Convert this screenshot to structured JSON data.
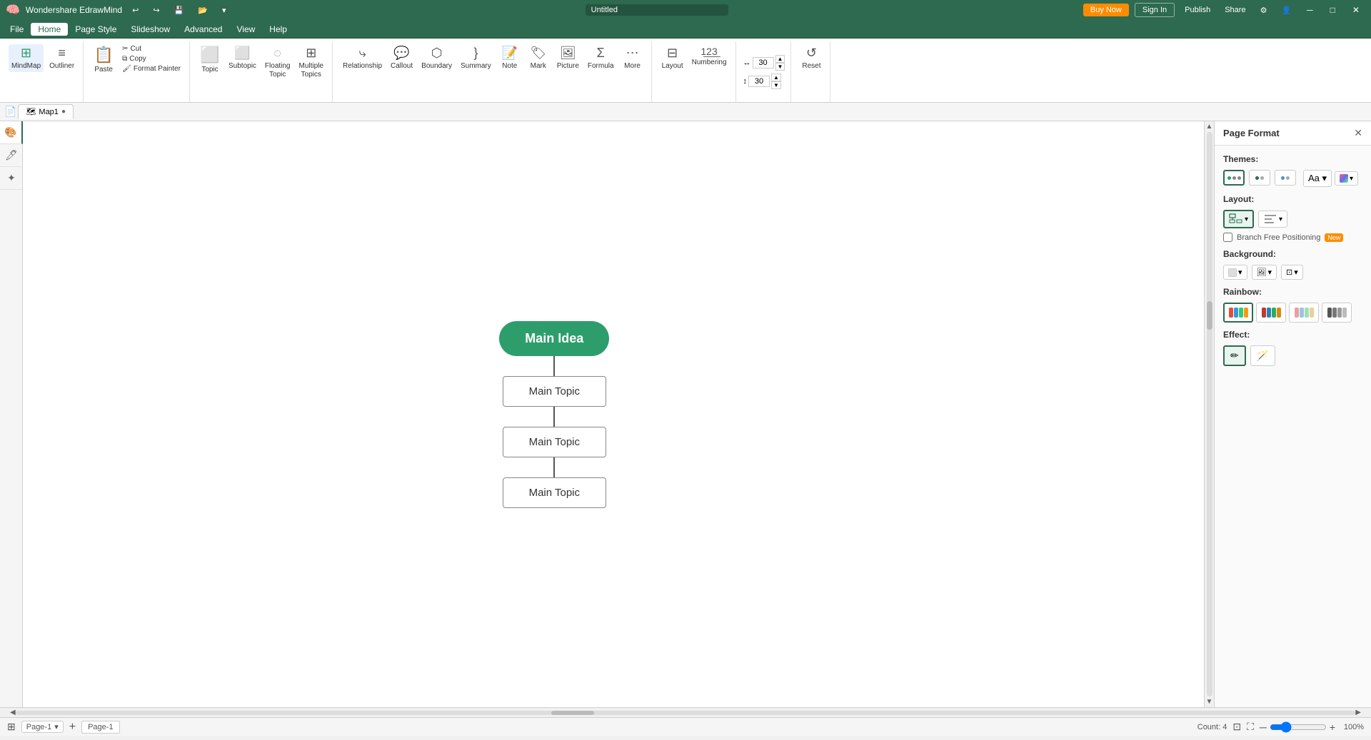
{
  "app": {
    "title": "Wondershare EdrawMind",
    "logo": "🧠"
  },
  "titlebar": {
    "buy_now": "Buy Now",
    "sign_in": "Sign In",
    "publish": "Publish",
    "share": "Share",
    "undo": "↩",
    "redo": "↪"
  },
  "menubar": {
    "items": [
      "File",
      "Home",
      "Page Style",
      "Slideshow",
      "Advanced",
      "View",
      "Help"
    ]
  },
  "ribbon": {
    "groups": [
      {
        "name": "views",
        "items": [
          {
            "id": "mindmap",
            "label": "MindMap",
            "icon": "⊞",
            "active": true
          },
          {
            "id": "outliner",
            "label": "Outliner",
            "icon": "≡"
          }
        ]
      },
      {
        "name": "clipboard",
        "items": [
          {
            "id": "paste",
            "label": "Paste",
            "icon": "📋"
          },
          {
            "id": "cut",
            "label": "Cut",
            "icon": "✂"
          },
          {
            "id": "copy",
            "label": "Copy",
            "icon": "⧉"
          },
          {
            "id": "format-painter",
            "label": "Format Painter",
            "icon": "🖌"
          }
        ]
      },
      {
        "name": "topics",
        "items": [
          {
            "id": "topic",
            "label": "Topic",
            "icon": "⬜"
          },
          {
            "id": "subtopic",
            "label": "Subtopic",
            "icon": "⬜"
          },
          {
            "id": "floating-topic",
            "label": "Floating Topic",
            "icon": "⬜"
          },
          {
            "id": "multiple-topics",
            "label": "Multiple Topics",
            "icon": "⬜"
          }
        ]
      },
      {
        "name": "insert",
        "items": [
          {
            "id": "relationship",
            "label": "Relationship",
            "icon": "⤷"
          },
          {
            "id": "callout",
            "label": "Callout",
            "icon": "💬"
          },
          {
            "id": "boundary",
            "label": "Boundary",
            "icon": "⬡"
          },
          {
            "id": "summary",
            "label": "Summary",
            "icon": "}"
          },
          {
            "id": "note",
            "label": "Note",
            "icon": "📝"
          },
          {
            "id": "mark",
            "label": "Mark",
            "icon": "🏷"
          },
          {
            "id": "picture",
            "label": "Picture",
            "icon": "🖼"
          },
          {
            "id": "formula",
            "label": "Formula",
            "icon": "Σ"
          },
          {
            "id": "more",
            "label": "More",
            "icon": "⋯"
          }
        ]
      },
      {
        "name": "layout-numbering",
        "items": [
          {
            "id": "layout",
            "label": "Layout",
            "icon": "⊟"
          },
          {
            "id": "numbering",
            "label": "Numbering",
            "icon": "123"
          }
        ]
      },
      {
        "name": "size",
        "spinner1": "30",
        "spinner2": "30"
      },
      {
        "name": "reset",
        "items": [
          {
            "id": "reset",
            "label": "Reset",
            "icon": "↺"
          }
        ]
      }
    ]
  },
  "tabs": [
    {
      "id": "map1",
      "label": "Map1",
      "active": true,
      "modified": true
    }
  ],
  "rightpanel": {
    "title": "Page Format",
    "sections": {
      "themes": {
        "label": "Themes:"
      },
      "layout": {
        "label": "Layout:",
        "branch_free": "Branch Free Positioning",
        "new_badge": "New"
      },
      "background": {
        "label": "Background:"
      },
      "rainbow": {
        "label": "Rainbow:"
      },
      "effect": {
        "label": "Effect:"
      }
    }
  },
  "mindmap": {
    "main_idea": "Main Idea",
    "topics": [
      {
        "label": "Main Topic"
      },
      {
        "label": "Main Topic"
      },
      {
        "label": "Main Topic"
      }
    ]
  },
  "statusbar": {
    "page_selector_label": "Page-1",
    "count_label": "Count: 4",
    "zoom_level": "100%"
  }
}
